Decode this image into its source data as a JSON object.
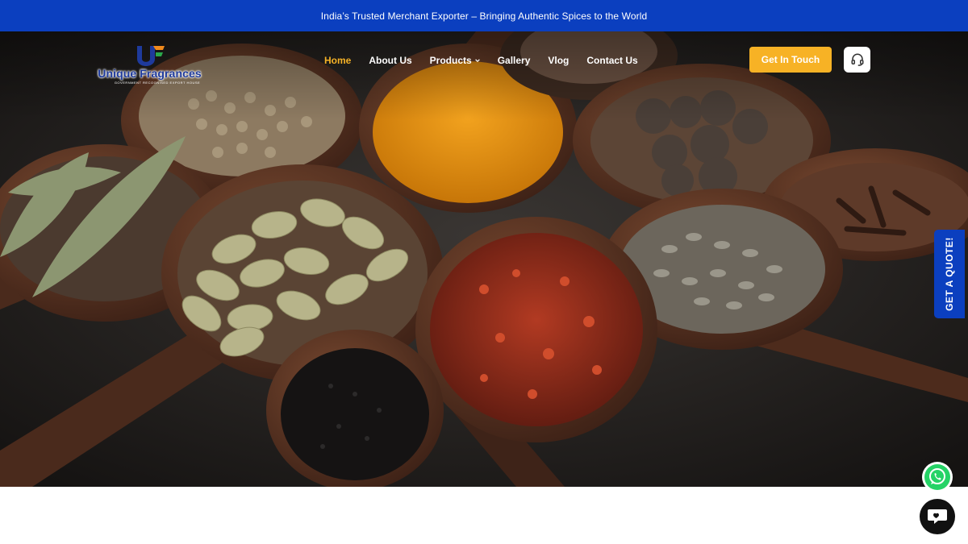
{
  "topbar": {
    "text": "India’s Trusted Merchant Exporter – Bringing Authentic Spices to the World",
    "bg_color": "#0b3fbf"
  },
  "header": {
    "logo": {
      "name": "Unique Fragrances",
      "tagline": "GOVERNMENT RECOGNISED EXPORT HOUSE",
      "icon": "uf-logo-mark"
    },
    "nav": [
      {
        "label": "Home",
        "active": true
      },
      {
        "label": "About Us",
        "active": false
      },
      {
        "label": "Products",
        "active": false,
        "has_dropdown": true
      },
      {
        "label": "Gallery",
        "active": false
      },
      {
        "label": "Vlog",
        "active": false
      },
      {
        "label": "Contact Us",
        "active": false
      }
    ],
    "cta_label": "Get In Touch",
    "support_icon": "headset-icon"
  },
  "hero": {
    "image_description_icon": "spices-in-wooden-spoons"
  },
  "side_tab": {
    "label": "GET A QUOTE!"
  },
  "floating": {
    "whatsapp_icon": "whatsapp-icon",
    "chat_icon": "chat-bubble-icon"
  },
  "colors": {
    "accent": "#f7b225",
    "brand_blue": "#0b3fbf",
    "nav_active": "#f5b226"
  }
}
